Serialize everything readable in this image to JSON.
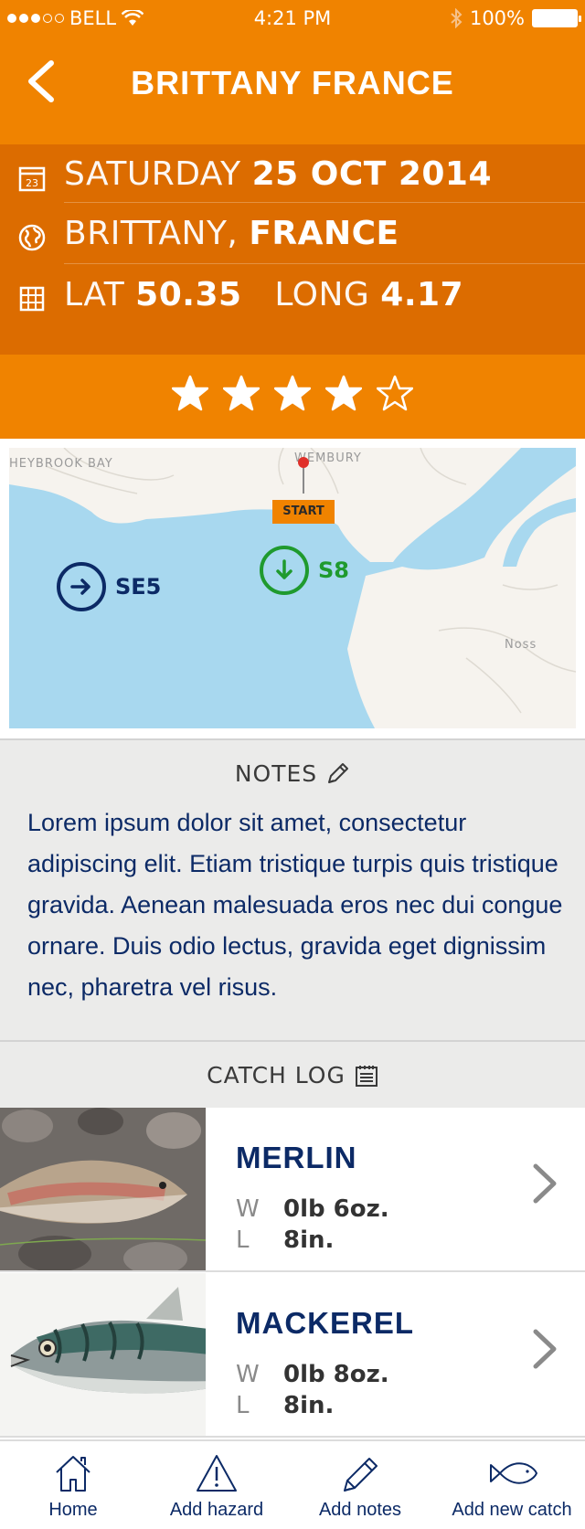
{
  "status_bar": {
    "carrier": "BELL",
    "time": "4:21 PM",
    "battery": "100%"
  },
  "header": {
    "title": "BRITTANY FRANCE"
  },
  "info": {
    "date_day": "SATURDAY",
    "date_value": "25 OCT 2014",
    "region": "BRITTANY,",
    "country": "FRANCE",
    "lat_label": "LAT",
    "lat_value": "50.35",
    "long_label": "LONG",
    "long_value": "4.17",
    "calendar_day": "23"
  },
  "rating": {
    "value": 4,
    "max": 5
  },
  "map": {
    "labels": {
      "place_left": "HEYBROOK BAY",
      "place_top": "WEMBURY",
      "place_right": "Noss"
    },
    "start_label": "START",
    "wind_1": {
      "label": "SE5",
      "color": "#0c2a66"
    },
    "wind_2": {
      "label": "S8",
      "color": "#1f9a2e"
    }
  },
  "notes": {
    "heading": "NOTES",
    "text": "Lorem ipsum dolor sit amet, consectetur adipiscing elit. Etiam tristique turpis quis tristique gravida. Aenean malesuada eros nec dui congue ornare. Duis odio lectus, gravida eget dignissim nec, pharetra vel risus."
  },
  "catch_log": {
    "heading": "CATCH LOG",
    "items": [
      {
        "name": "MERLIN",
        "weight_key": "W",
        "weight": "0lb  6oz.",
        "length_key": "L",
        "length": "8in."
      },
      {
        "name": "MACKEREL",
        "weight_key": "W",
        "weight": "0lb  8oz.",
        "length_key": "L",
        "length": "8in."
      }
    ]
  },
  "tabbar": {
    "home": "Home",
    "add_hazard": "Add hazard",
    "add_notes": "Add notes",
    "add_catch": "Add new catch"
  },
  "colors": {
    "accent": "#f08300",
    "accent_dark": "#dc6c00",
    "navy": "#0c2a66",
    "green": "#1f9a2e",
    "water": "#a8d8ef",
    "land": "#f6f3ee"
  }
}
